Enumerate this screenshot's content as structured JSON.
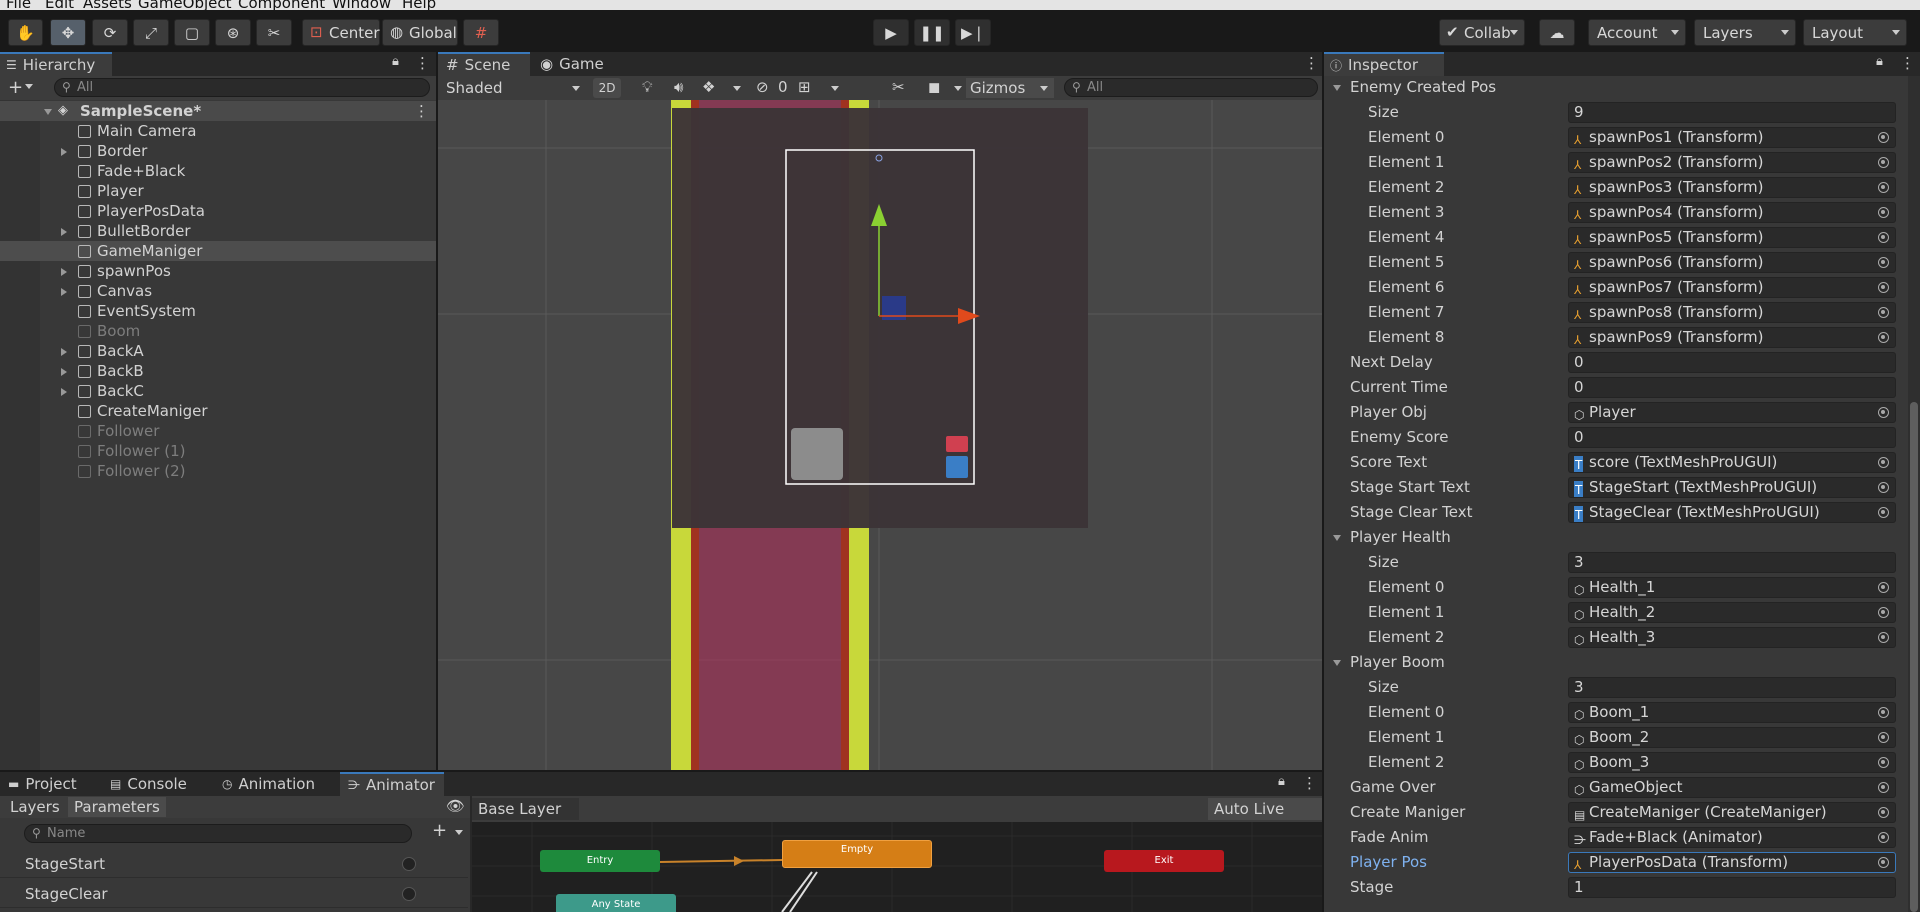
{
  "menu": [
    "File",
    "Edit",
    "Assets",
    "GameObject",
    "Component",
    "Window",
    "Help"
  ],
  "toolbar": {
    "pivot_label": "Center",
    "space_label": "Global",
    "collab_label": "Collab",
    "account_label": "Account",
    "layers_label": "Layers",
    "layout_label": "Layout"
  },
  "hierarchy": {
    "tab_label": "Hierarchy",
    "search_placeholder": "All",
    "scene_name": "SampleScene*",
    "items": [
      {
        "label": "Main Camera"
      },
      {
        "label": "Border"
      },
      {
        "label": "Fade+Black"
      },
      {
        "label": "Player"
      },
      {
        "label": "PlayerPosData"
      },
      {
        "label": "BulletBorder"
      },
      {
        "label": "GameManiger"
      },
      {
        "label": "spawnPos"
      },
      {
        "label": "Canvas"
      },
      {
        "label": "EventSystem"
      },
      {
        "label": "Boom"
      },
      {
        "label": "BackA"
      },
      {
        "label": "BackB"
      },
      {
        "label": "BackC"
      },
      {
        "label": "CreateManiger"
      },
      {
        "label": "Follower"
      },
      {
        "label": "Follower (1)"
      },
      {
        "label": "Follower (2)"
      }
    ]
  },
  "scene": {
    "tab_scene": "Scene",
    "tab_game": "Game",
    "shading_mode": "Shaded",
    "mode_2d": "2D",
    "hidden_count": "0",
    "gizmos_label": "Gizmos",
    "search_placeholder": "All"
  },
  "inspector": {
    "tab_label": "Inspector",
    "sections": [
      {
        "label": "Enemy Created Pos",
        "size": "9",
        "elements": [
          {
            "label": "Element 0",
            "value": "spawnPos1 (Transform)"
          },
          {
            "label": "Element 1",
            "value": "spawnPos2 (Transform)"
          },
          {
            "label": "Element 2",
            "value": "spawnPos3 (Transform)"
          },
          {
            "label": "Element 3",
            "value": "spawnPos4 (Transform)"
          },
          {
            "label": "Element 4",
            "value": "spawnPos5 (Transform)"
          },
          {
            "label": "Element 5",
            "value": "spawnPos6 (Transform)"
          },
          {
            "label": "Element 6",
            "value": "spawnPos7 (Transform)"
          },
          {
            "label": "Element 7",
            "value": "spawnPos8 (Transform)"
          },
          {
            "label": "Element 8",
            "value": "spawnPos9 (Transform)"
          }
        ]
      },
      {
        "label": "Player Health",
        "size": "3",
        "elements": [
          {
            "label": "Element 0",
            "value": "Health_1"
          },
          {
            "label": "Element 1",
            "value": "Health_2"
          },
          {
            "label": "Element 2",
            "value": "Health_3"
          }
        ]
      },
      {
        "label": "Player Boom",
        "size": "3",
        "elements": [
          {
            "label": "Element 0",
            "value": "Boom_1"
          },
          {
            "label": "Element 1",
            "value": "Boom_2"
          },
          {
            "label": "Element 2",
            "value": "Boom_3"
          }
        ]
      }
    ],
    "size_label": "Size",
    "fields": [
      {
        "label": "Next Delay",
        "value": "0"
      },
      {
        "label": "Current Time",
        "value": "0"
      },
      {
        "label": "Player Obj",
        "value": "Player"
      },
      {
        "label": "Enemy Score",
        "value": "0"
      },
      {
        "label": "Score Text",
        "value": "score (TextMeshProUGUI)"
      },
      {
        "label": "Stage Start Text",
        "value": "StageStart (TextMeshProUGUI)"
      },
      {
        "label": "Stage Clear Text",
        "value": "StageClear (TextMeshProUGUI)"
      },
      {
        "label": "Game Over",
        "value": "GameObject"
      },
      {
        "label": "Create Maniger",
        "value": "CreateManiger (CreateManiger)"
      },
      {
        "label": "Fade Anim",
        "value": "Fade+Black (Animator)"
      },
      {
        "label": "Player Pos",
        "value": "PlayerPosData (Transform)"
      },
      {
        "label": "Stage",
        "value": "1"
      }
    ]
  },
  "bottom": {
    "tabs": [
      "Project",
      "Console",
      "Animation",
      "Animator"
    ],
    "subtabs": [
      "Layers",
      "Parameters"
    ],
    "param_search_placeholder": "Name",
    "base_layer": "Base Layer",
    "auto_live_link": "Auto Live Link",
    "parameters": [
      {
        "label": "StageStart"
      },
      {
        "label": "StageClear"
      }
    ],
    "nodes": {
      "entry": "Entry",
      "empty": "Empty",
      "exit": "Exit",
      "any_state": "Any State"
    }
  },
  "colors": {
    "accent": "#3a79bb",
    "node_entry": "#1e8a3c",
    "node_default": "#d57e16",
    "node_exit": "#b8181e",
    "node_any": "#3d9a8a"
  }
}
